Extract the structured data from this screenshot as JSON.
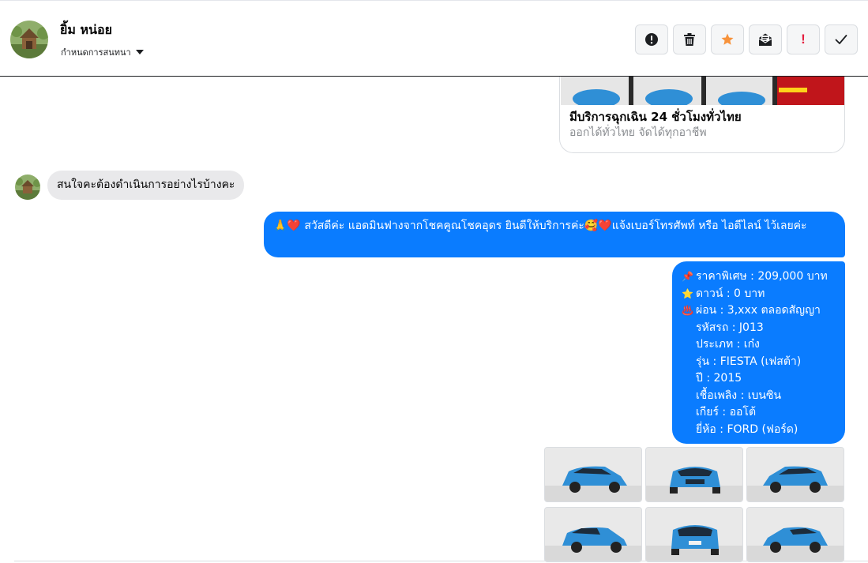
{
  "header": {
    "contact_name": "ยิ้ม หน่อย",
    "assign_label": "กำหนดการสนทนา",
    "actions": [
      {
        "name": "spam",
        "icon": "alert-circle-icon"
      },
      {
        "name": "delete",
        "icon": "trash-icon"
      },
      {
        "name": "star",
        "icon": "star-icon",
        "color": "#f7923b"
      },
      {
        "name": "mark-unread",
        "icon": "envelope-open-icon"
      },
      {
        "name": "follow-up",
        "icon": "exclamation-icon",
        "label": "!",
        "color": "#e41e3f"
      },
      {
        "name": "done",
        "icon": "checkmark-icon"
      }
    ]
  },
  "link_card": {
    "title": "มีบริการฉุกเฉิน 24 ชั่วโมงทั่วไทย",
    "subtitle": "ออกได้ทั่วไทย จัดได้ทุกอาชีพ"
  },
  "incoming": {
    "text": "สนใจคะต้องดำเนินการอย่างไรบ้างคะ"
  },
  "outgoing_greeting": {
    "text": "🙏❤️ สวัสดีค่ะ แอดมินฟางจากโชคคูณโชคอุดร ยินดีให้บริการค่ะ🥰❤️แจ้งเบอร์โทรศัพท์ หรือ ไอดีไลน์  ไว้เลยค่ะ"
  },
  "car_details": {
    "lines": [
      {
        "icon": "📌",
        "text": "ราคาพิเศษ : 209,000 บาท"
      },
      {
        "icon": "⭐",
        "text": "ดาวน์ : 0 บาท"
      },
      {
        "icon": "♨️",
        "text": "ผ่อน : 3,xxx ตลอดสัญญา"
      },
      {
        "icon": "",
        "text": "รหัสรถ : J013"
      },
      {
        "icon": "",
        "text": "ประเภท : เก๋ง"
      },
      {
        "icon": "",
        "text": "รุ่น : FIESTA (เฟสต้า)"
      },
      {
        "icon": "",
        "text": "ปี : 2015"
      },
      {
        "icon": "",
        "text": "เชื้อเพลิง : เบนซิน"
      },
      {
        "icon": "",
        "text": "เกียร์ : ออโต้"
      },
      {
        "icon": "",
        "text": "ยี่ห้อ : FORD (ฟอร์ด)"
      }
    ]
  },
  "colors": {
    "accent": "#0a7cff",
    "incoming_bubble": "#e9e9eb",
    "car_blue": "#2f8fd6"
  }
}
